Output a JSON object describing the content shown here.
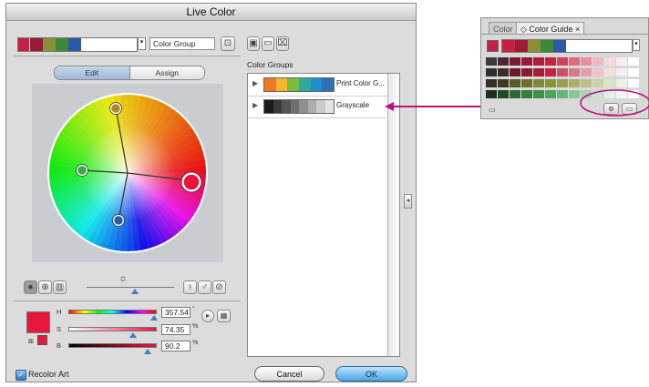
{
  "dialog": {
    "title": "Live Color",
    "group_name_value": "Color Group",
    "tabs": [
      "Edit",
      "Assign"
    ],
    "color_groups_header": "Color Groups",
    "groups": [
      {
        "name": "Print Color G...",
        "swatches": [
          "#f07821",
          "#f7b52a",
          "#79bb3b",
          "#2fa7a0",
          "#1f8fd0",
          "#2d6fb3"
        ]
      },
      {
        "name": "Grayscale",
        "swatches": [
          "#1a1a1a",
          "#3a3a3a",
          "#555555",
          "#707070",
          "#8f8f8f",
          "#adadad",
          "#cacaca",
          "#e5e5e5"
        ]
      }
    ],
    "active_group_swatches": [
      "#c62043",
      "#9a1a33",
      "#8a9035",
      "#3a8a3a",
      "#2a5aa8"
    ],
    "sliders": [
      {
        "label": "H",
        "value": "357.54",
        "unit": "°",
        "position": 0.97
      },
      {
        "label": "S",
        "value": "74.35",
        "unit": "%",
        "position": 0.73
      },
      {
        "label": "B",
        "value": "90.2",
        "unit": "%",
        "position": 0.9
      }
    ],
    "base_color": "#e8153c",
    "recolor_art_label": "Recolor Art",
    "recolor_art_checked": true,
    "cancel_label": "Cancel",
    "ok_label": "OK",
    "brightness_icon": "sun-icon"
  },
  "palette": {
    "tabs": [
      "Color",
      "◇ Color Guide ×"
    ],
    "base_swatch": "#c62043",
    "harmony_swatches": [
      "#c62043",
      "#a11a35",
      "#8a9035",
      "#3a8a3a",
      "#2a5aa8"
    ]
  },
  "colors": {
    "accent": "#c0107a",
    "ok_blue": "#4ba5e6",
    "wheel_center_marker": "#e8153c"
  }
}
